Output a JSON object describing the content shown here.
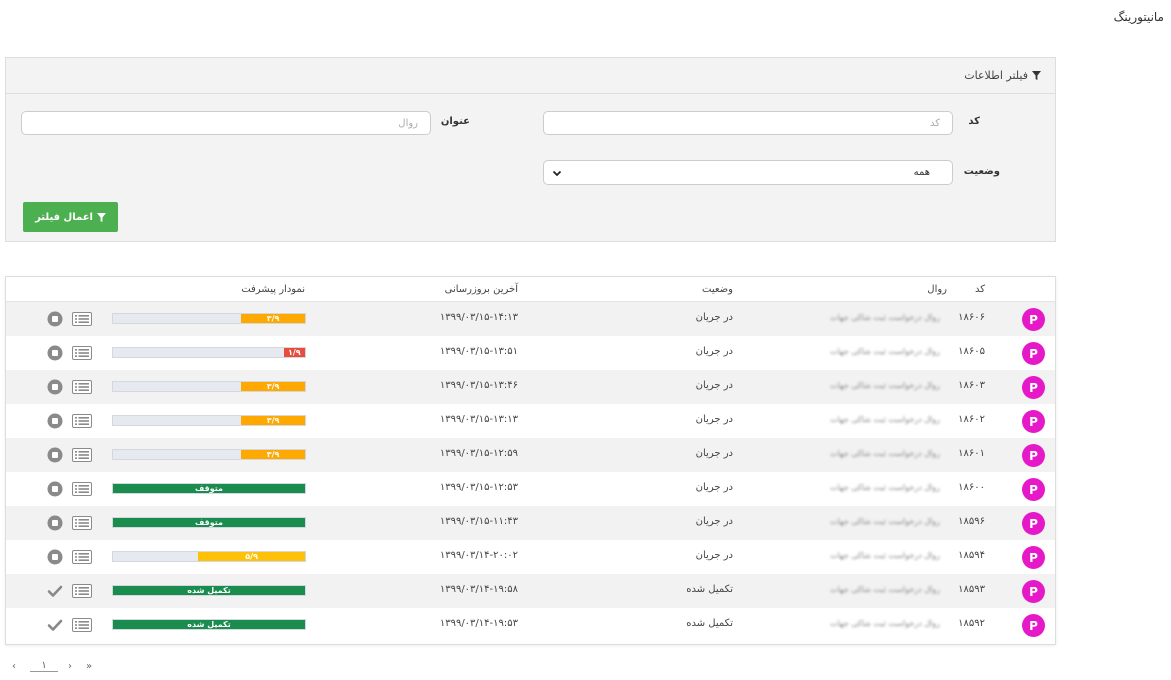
{
  "page": {
    "title": "مانیتورینگ"
  },
  "filter": {
    "header": "فیلتر اطلاعات",
    "code_label": "کد",
    "code_placeholder": "کد",
    "title_label": "عنوان",
    "title_placeholder": "روال",
    "status_label": "وضعیت",
    "status_value": "همه",
    "apply_label": "اعمال فیلتر"
  },
  "table": {
    "columns": {
      "code": "کد",
      "process": "روال",
      "status": "وضعیت",
      "last_update": "آخرین بروزرسانی",
      "progress": "نمودار پیشرفت"
    },
    "rows": [
      {
        "badge": "P",
        "code": "۱۸۶۰۶",
        "process": "روال درخواست ثبت شاکی جهات",
        "status": "در جریان",
        "updated": "۱۳۹۹/۰۳/۱۵-۱۴:۱۳",
        "progress_label": "۳/۹",
        "progress": 0.333,
        "bar_color": "#ffa800",
        "action": "stop"
      },
      {
        "badge": "P",
        "code": "۱۸۶۰۵",
        "process": "روال درخواست ثبت شاکی جهات",
        "status": "در جریان",
        "updated": "۱۳۹۹/۰۳/۱۵-۱۳:۵۱",
        "progress_label": "۱/۹",
        "progress": 0.111,
        "bar_color": "#e74c3c",
        "action": "stop"
      },
      {
        "badge": "P",
        "code": "۱۸۶۰۳",
        "process": "روال درخواست ثبت شاکی جهات",
        "status": "در جریان",
        "updated": "۱۳۹۹/۰۳/۱۵-۱۳:۴۶",
        "progress_label": "۳/۹",
        "progress": 0.333,
        "bar_color": "#ffa800",
        "action": "stop"
      },
      {
        "badge": "P",
        "code": "۱۸۶۰۲",
        "process": "روال درخواست ثبت شاکی جهات",
        "status": "در جریان",
        "updated": "۱۳۹۹/۰۳/۱۵-۱۳:۱۳",
        "progress_label": "۳/۹",
        "progress": 0.333,
        "bar_color": "#ffa800",
        "action": "stop"
      },
      {
        "badge": "P",
        "code": "۱۸۶۰۱",
        "process": "روال درخواست ثبت شاکی جهات",
        "status": "در جریان",
        "updated": "۱۳۹۹/۰۳/۱۵-۱۲:۵۹",
        "progress_label": "۳/۹",
        "progress": 0.333,
        "bar_color": "#ffa800",
        "action": "stop"
      },
      {
        "badge": "P",
        "code": "۱۸۶۰۰",
        "process": "روال درخواست ثبت شاکی جهات",
        "status": "در جریان",
        "updated": "۱۳۹۹/۰۳/۱۵-۱۲:۵۳",
        "progress_label": "متوقف",
        "progress": 1,
        "bar_color": "#1a8d4e",
        "action": "stop"
      },
      {
        "badge": "P",
        "code": "۱۸۵۹۶",
        "process": "روال درخواست ثبت شاکی جهات",
        "status": "در جریان",
        "updated": "۱۳۹۹/۰۳/۱۵-۱۱:۴۳",
        "progress_label": "متوقف",
        "progress": 1,
        "bar_color": "#1a8d4e",
        "action": "stop"
      },
      {
        "badge": "P",
        "code": "۱۸۵۹۴",
        "process": "روال درخواست ثبت شاکی جهات",
        "status": "در جریان",
        "updated": "۱۳۹۹/۰۳/۱۴-۲۰:۰۲",
        "progress_label": "۵/۹",
        "progress": 0.556,
        "bar_color": "#ffc107",
        "action": "stop"
      },
      {
        "badge": "P",
        "code": "۱۸۵۹۳",
        "process": "روال درخواست ثبت شاکی جهات",
        "status": "تکمیل شده",
        "updated": "۱۳۹۹/۰۳/۱۴-۱۹:۵۸",
        "progress_label": "تکمیل شده",
        "progress": 1,
        "bar_color": "#1a8d4e",
        "action": "done"
      },
      {
        "badge": "P",
        "code": "۱۸۵۹۲",
        "process": "روال درخواست ثبت شاکی جهات",
        "status": "تکمیل شده",
        "updated": "۱۳۹۹/۰۳/۱۴-۱۹:۵۳",
        "progress_label": "تکمیل شده",
        "progress": 1,
        "bar_color": "#1a8d4e",
        "action": "done"
      }
    ]
  },
  "pagination": {
    "prev": "‹",
    "current": "۱",
    "next": "›",
    "last": "»"
  }
}
